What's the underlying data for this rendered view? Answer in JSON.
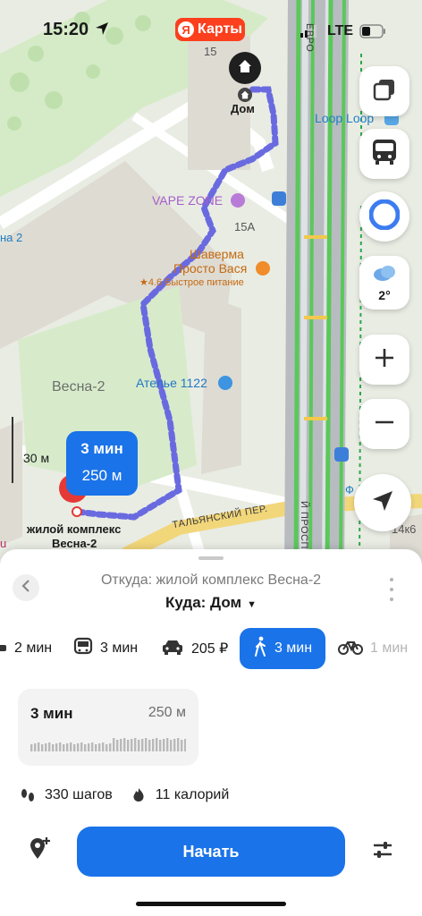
{
  "status_bar": {
    "time": "15:20",
    "network": "LTE"
  },
  "map": {
    "brand": {
      "logo": "Я",
      "name": "Карты"
    },
    "building_numbers": [
      "15",
      "15А",
      "14к6"
    ],
    "home_label": "Дом",
    "pois": [
      {
        "name": "Loop Loop",
        "icon": "shopping-bag-icon"
      },
      {
        "name": "VAPE ZONE",
        "icon": "shop-icon"
      },
      {
        "name_line1": "Шаверма",
        "name_line2": "Просто Вася",
        "rating": "★4.6 Быстрое питание",
        "icon": "fast-food-icon"
      },
      {
        "name": "Атель​е 1122",
        "icon": "tshirt-icon"
      }
    ],
    "area_label": "Весна-2",
    "left_fragment": "на 2",
    "scale_text": "30 м",
    "start_label_line1": "жилой комплекс",
    "start_label_line2": "Весна-2",
    "left_edge_u": "u",
    "streets": {
      "italian": "ТАЛЬЯНСКИЙ ПЕР.",
      "prospect_top": "ЕВРО",
      "prospect_side": "Й ПРОСП.",
      "metro_letter": "Ф"
    },
    "route_bubble": {
      "time": "3 мин",
      "distance": "250 м"
    },
    "weather": {
      "temp": "2°"
    },
    "colors": {
      "route": "#6a6ae0",
      "traffic_green": "#5ac85a",
      "accent_blue": "#1a73e8",
      "brand_red": "#fc3f1d"
    }
  },
  "controls": [
    "layers-icon",
    "transit-icon",
    "alice-icon",
    "weather-icon",
    "zoom-in-icon",
    "zoom-out-icon",
    "locate-icon"
  ],
  "sheet": {
    "from": "Откуда: жилой комплекс Весна-2",
    "to": "Куда: Дом",
    "modes": [
      {
        "icon": "car-icon",
        "label": "2 мин"
      },
      {
        "icon": "bus-icon",
        "label": "3 мин"
      },
      {
        "icon": "taxi-icon",
        "label": "205 ₽"
      },
      {
        "icon": "walk-icon",
        "label": "3 мин",
        "active": true
      },
      {
        "icon": "bike-icon",
        "label": "1 мин"
      }
    ],
    "route_card": {
      "time": "3 мин",
      "distance": "250 м"
    },
    "stats": {
      "steps": "330 шагов",
      "calories": "11 калорий"
    },
    "start_button": "Начать"
  }
}
